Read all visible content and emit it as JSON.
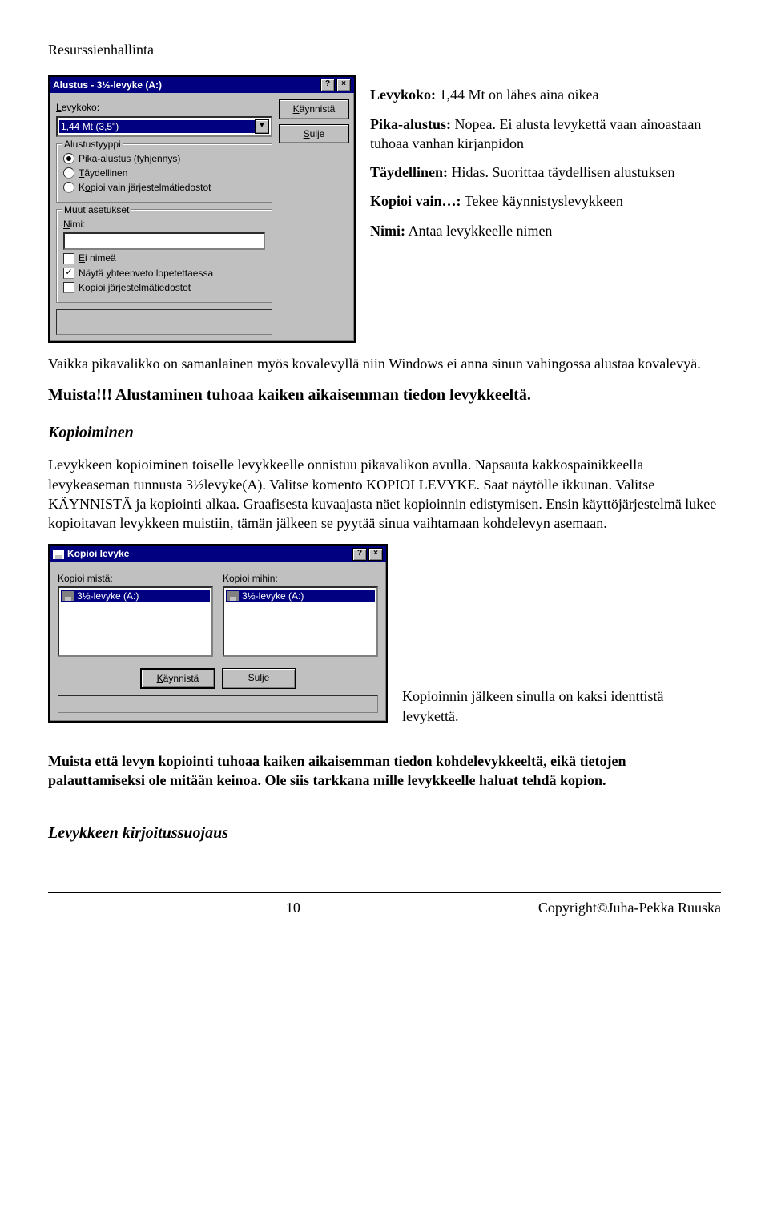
{
  "header": "Resurssienhallinta",
  "dialog1": {
    "title": "Alustus - 3½-levyke (A:)",
    "help": "?",
    "close": "×",
    "capacity_label": "Levykoko:",
    "capacity_value": "1,44 Mt (3,5\")",
    "start_underline": "K",
    "start_rest": "äynnistä",
    "close_underline": "S",
    "close_rest": "ulje",
    "group_type": "Alustustyyppi",
    "r1_underline": "P",
    "r1_rest": "ika-alustus (tyhjennys)",
    "r2_underline": "T",
    "r2_rest": "äydellinen",
    "r3_pre": "K",
    "r3_underline": "o",
    "r3_rest": "pioi vain järjestelmätiedostot",
    "group_other": "Muut asetukset",
    "name_label": "Nimi:",
    "c1_underline": "E",
    "c1_rest": "i nimeä",
    "c2_pre": "Näytä ",
    "c2_underline": "y",
    "c2_rest": "hteenveto lopetettaessa",
    "c3_pre": "Kopioi ",
    "c3_underline": "j",
    "c3_rest": "ärjestelmätiedostot"
  },
  "desc": {
    "levykoko_label": "Levykoko:",
    "levykoko_text": " 1,44 Mt on lähes aina oikea",
    "pika_label": "Pika-alustus:",
    "pika_text": " Nopea. Ei alusta levykettä vaan ainoastaan tuhoaa vanhan kirjanpidon",
    "tayd_label": "Täydellinen:",
    "tayd_text": " Hidas. Suorittaa täydellisen alustuksen",
    "kopioi_label": "Kopioi vain…:",
    "kopioi_text": " Tekee käynnistyslevykkeen",
    "nimi_label": "Nimi:",
    "nimi_text": " Antaa levykkeelle nimen"
  },
  "para1": "Vaikka pikavalikko on samanlainen myös kovalevyllä niin Windows ei anna sinun vahingossa alustaa kovalevyä.",
  "muista": "Muista!!! Alustaminen tuhoaa kaiken aikaisemman tiedon levykkeeltä.",
  "kop_hdr": "Kopioiminen",
  "para2": "Levykkeen kopioiminen toiselle levykkeelle onnistuu pikavalikon avulla. Napsauta kakkospainikkeella levykeaseman tunnusta 3½levyke(A). Valitse komento KOPIOI LEVYKE. Saat näytölle ikkunan. Valitse KÄYNNISTÄ ja kopiointi alkaa. Graafisesta kuvaajasta näet kopioinnin edistymisen. Ensin käyttöjärjestelmä lukee kopioitavan levykkeen muistiin, tämän jälkeen se pyytää sinua vaihtamaan kohdelevyn asemaan.",
  "dialog2": {
    "title": "Kopioi levyke",
    "help": "?",
    "close": "×",
    "from_label": "Kopioi mistä:",
    "to_label": "Kopioi mihin:",
    "item": "3½-levyke (A:)",
    "start_underline": "K",
    "start_rest": "äynnistä",
    "close_underline": "S",
    "close_rest": "ulje"
  },
  "desc2": "Kopioinnin jälkeen sinulla on kaksi identtistä levykettä.",
  "para3": "Muista että levyn kopiointi tuhoaa kaiken aikaisemman tiedon kohdelevykkeeltä, eikä tietojen palauttamiseksi ole mitään keinoa. Ole siis tarkkana mille levykkeelle haluat tehdä kopion.",
  "wprot_hdr": "Levykkeen kirjoitussuojaus",
  "footer": {
    "page": "10",
    "copyright": "Copyright©Juha-Pekka Ruuska"
  }
}
